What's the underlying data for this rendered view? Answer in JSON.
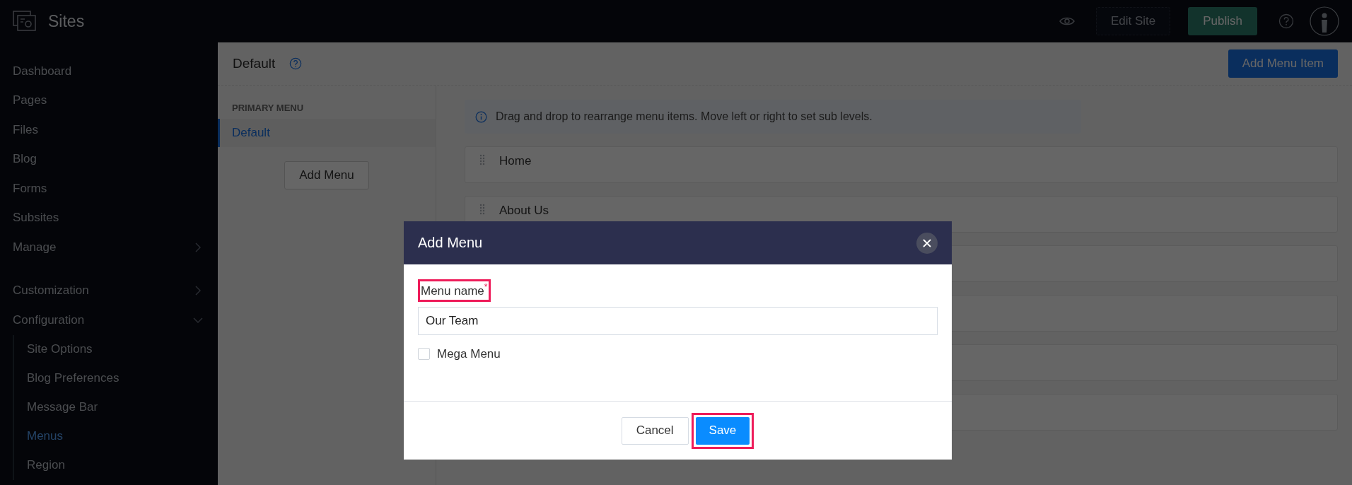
{
  "app": {
    "title": "Sites"
  },
  "topbar": {
    "edit_button": "Edit Site",
    "publish_button": "Publish"
  },
  "sidebar": {
    "groups": [
      {
        "items": [
          {
            "label": "Dashboard",
            "selected": false
          },
          {
            "label": "Pages",
            "selected": false
          },
          {
            "label": "Files",
            "selected": false
          },
          {
            "label": "Blog",
            "selected": false
          },
          {
            "label": "Forms",
            "selected": false
          },
          {
            "label": "Subsites",
            "selected": false
          },
          {
            "label": "Manage",
            "selected": false,
            "expanded": false
          }
        ]
      },
      {
        "items": [
          {
            "label": "Customization",
            "selected": false,
            "expanded": false
          },
          {
            "label": "Configuration",
            "selected": false,
            "expanded": true,
            "children": [
              {
                "label": "Site Options",
                "selected": false
              },
              {
                "label": "Blog Preferences",
                "selected": false
              },
              {
                "label": "Message Bar",
                "selected": false
              },
              {
                "label": "Menus",
                "selected": true
              },
              {
                "label": "Region",
                "selected": false
              }
            ]
          }
        ]
      }
    ]
  },
  "header": {
    "title": "Default",
    "action_button": "Add Menu Item"
  },
  "menus_panel": {
    "section_title": "PRIMARY MENU",
    "menus": [
      {
        "label": "Default",
        "selected": true
      }
    ],
    "add_button": "Add Menu"
  },
  "info_message": "Drag and drop to rearrange menu items. Move left or right to set sub levels.",
  "menu_items": [
    {
      "kind": "item",
      "label": "Home"
    },
    {
      "kind": "item",
      "label": "About Us"
    },
    {
      "kind": "covered"
    },
    {
      "kind": "covered"
    },
    {
      "kind": "covered"
    },
    {
      "kind": "covered"
    }
  ],
  "dialog": {
    "title": "Add Menu",
    "field_label": "Menu name",
    "required_mark": "*",
    "field_value": "Our Team",
    "mega_menu": {
      "label": "Mega Menu",
      "checked": false
    },
    "cancel_button": "Cancel",
    "save_button": "Save",
    "label_highlighted": true,
    "save_highlighted": true
  }
}
